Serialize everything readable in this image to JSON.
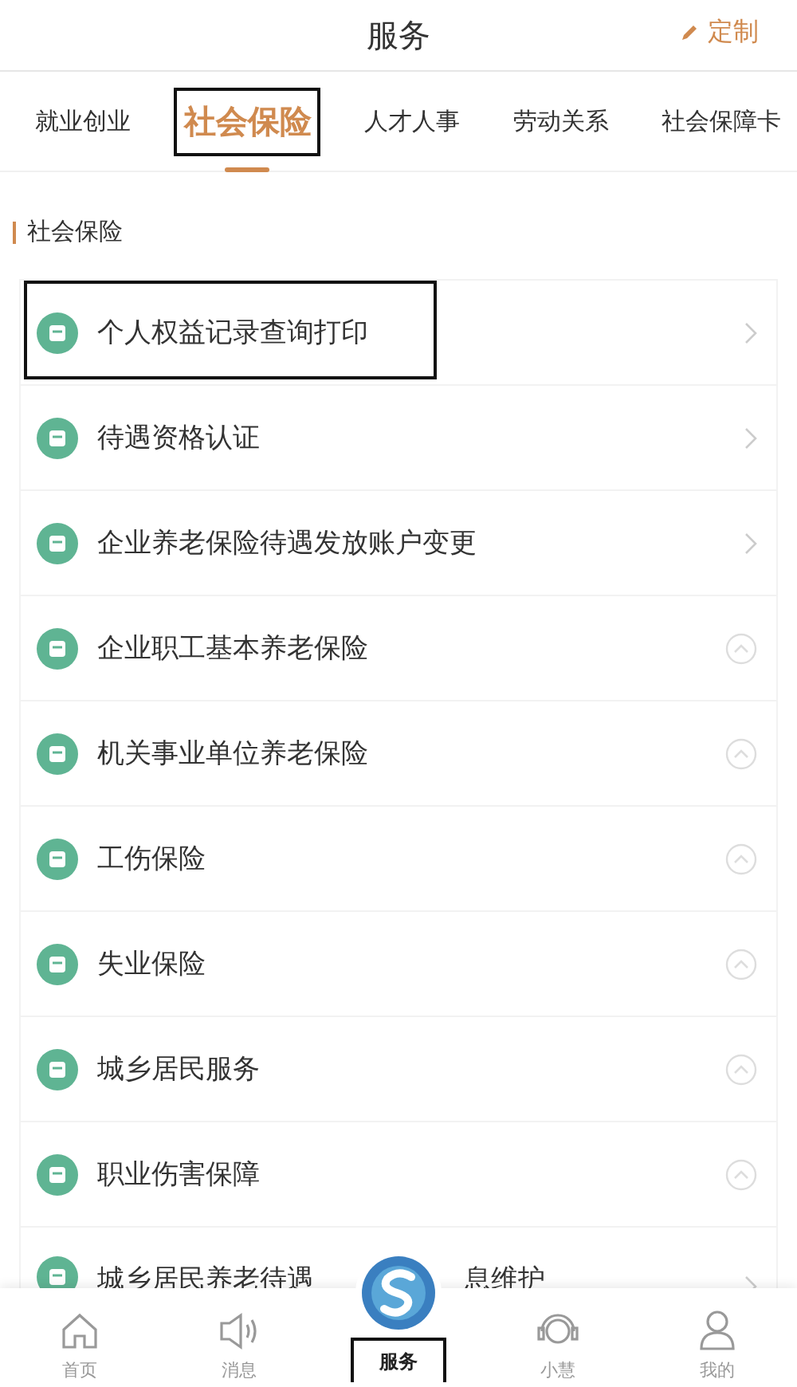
{
  "header": {
    "title": "服务",
    "action": "定制"
  },
  "tabs": [
    {
      "label": "就业创业",
      "selected": false,
      "highlighted": false
    },
    {
      "label": "社会保险",
      "selected": true,
      "highlighted": true
    },
    {
      "label": "人才人事",
      "selected": false,
      "highlighted": false
    },
    {
      "label": "劳动关系",
      "selected": false,
      "highlighted": false
    },
    {
      "label": "社会保障卡",
      "selected": false,
      "highlighted": false
    }
  ],
  "section": {
    "title": "社会保险"
  },
  "items": [
    {
      "label": "个人权益记录查询打印",
      "kind": "link",
      "highlighted": true
    },
    {
      "label": "待遇资格认证",
      "kind": "link",
      "highlighted": false
    },
    {
      "label": "企业养老保险待遇发放账户变更",
      "kind": "link",
      "highlighted": false
    },
    {
      "label": "企业职工基本养老保险",
      "kind": "group",
      "highlighted": false
    },
    {
      "label": "机关事业单位养老保险",
      "kind": "group",
      "highlighted": false
    },
    {
      "label": "工伤保险",
      "kind": "group",
      "highlighted": false
    },
    {
      "label": "失业保险",
      "kind": "group",
      "highlighted": false
    },
    {
      "label": "城乡居民服务",
      "kind": "group",
      "highlighted": false
    },
    {
      "label": "职业伤害保障",
      "kind": "group",
      "highlighted": false
    },
    {
      "label": "城乡居民养老待遇",
      "label_tail": "息维护",
      "kind": "link",
      "highlighted": false
    }
  ],
  "nav": [
    {
      "label": "首页",
      "kind": "home",
      "selected": false,
      "highlighted": false
    },
    {
      "label": "消息",
      "kind": "speaker",
      "selected": false,
      "highlighted": false
    },
    {
      "label": "服务",
      "kind": "logo",
      "selected": true,
      "highlighted": true
    },
    {
      "label": "小慧",
      "kind": "headset",
      "selected": false,
      "highlighted": false
    },
    {
      "label": "我的",
      "kind": "person",
      "selected": false,
      "highlighted": false
    }
  ]
}
